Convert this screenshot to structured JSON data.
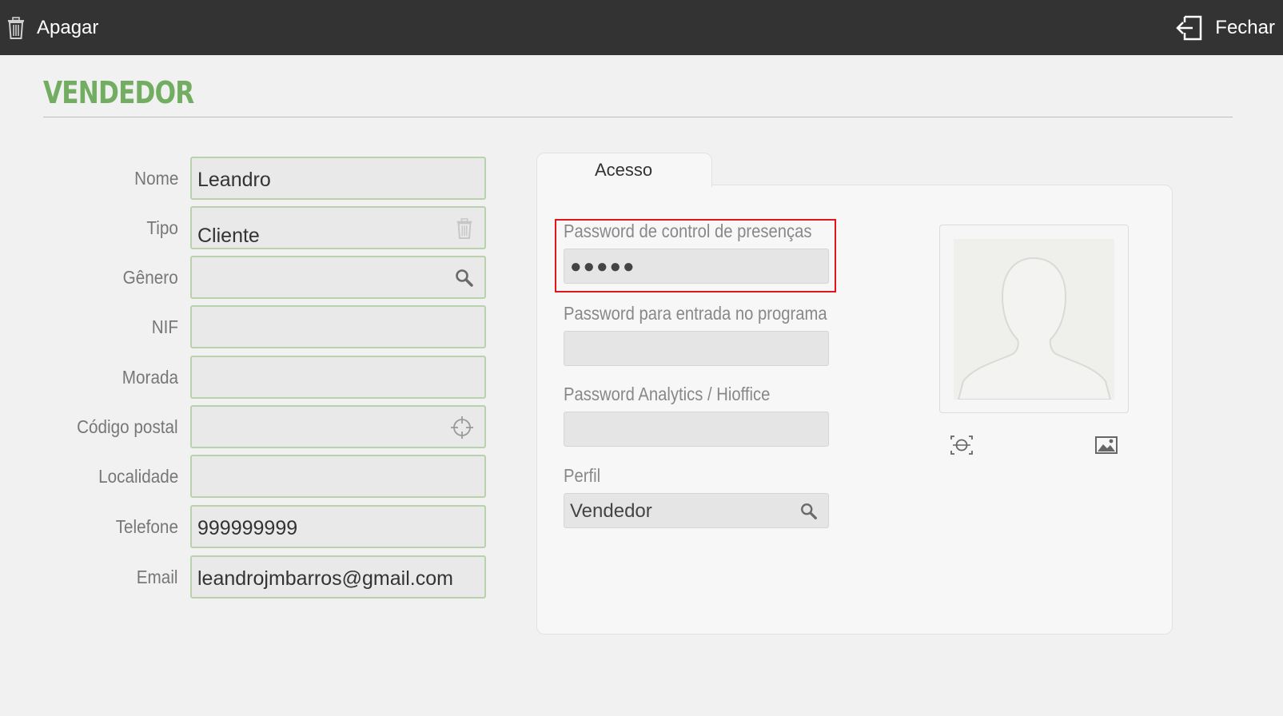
{
  "toolbar": {
    "delete_label": "Apagar",
    "close_label": "Fechar"
  },
  "page": {
    "title": "VENDEDOR"
  },
  "form": {
    "fields": [
      {
        "label": "Nome",
        "value": "Leandro"
      },
      {
        "label": "Tipo",
        "value": "Cliente",
        "icon": "trash-icon"
      },
      {
        "label": "Gênero",
        "value": "",
        "icon": "search-icon"
      },
      {
        "label": "NIF",
        "value": ""
      },
      {
        "label": "Morada",
        "value": ""
      },
      {
        "label": "Código postal",
        "value": "",
        "icon": "crosshair-icon"
      },
      {
        "label": "Localidade",
        "value": ""
      },
      {
        "label": "Telefone",
        "value": "999999999"
      },
      {
        "label": "Email",
        "value": "leandrojmbarros@gmail.com"
      }
    ]
  },
  "access": {
    "tab_label": "Acesso",
    "attendance_password_label": "Password de control de presenças",
    "attendance_password_value": "●●●●●",
    "program_password_label": "Password para entrada no programa",
    "program_password_value": "",
    "analytics_password_label": "Password Analytics / Hioffice",
    "analytics_password_value": "",
    "profile_label": "Perfil",
    "profile_value": "Vendedor"
  },
  "photo": {
    "placeholder_icon": "avatar-silhouette-icon",
    "camera_icon": "camera-icon",
    "gallery_icon": "image-icon"
  },
  "colors": {
    "topbar": "#333333",
    "title_green": "#72ad62",
    "input_border_green": "#b9d1ad",
    "highlight_red": "#e3151b"
  }
}
